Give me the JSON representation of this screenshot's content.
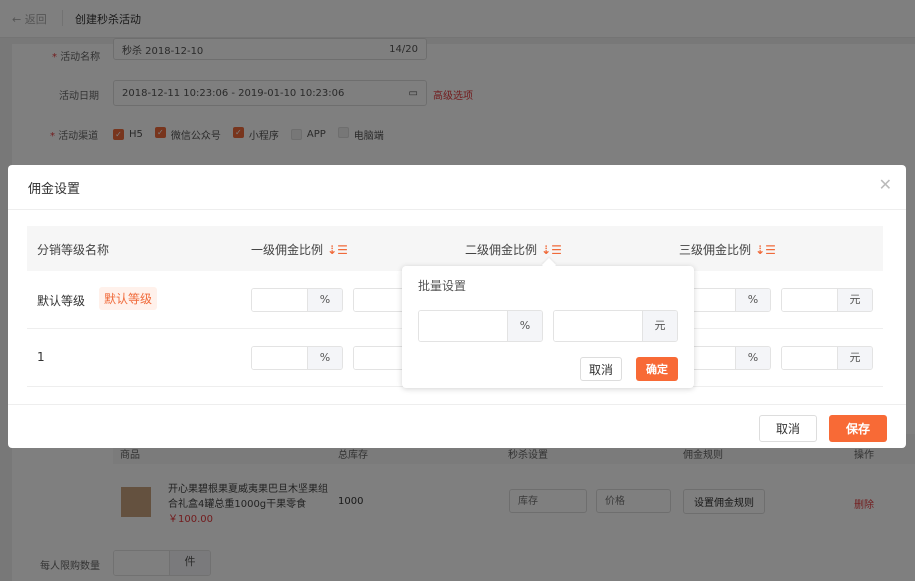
{
  "topbar": {
    "back": "返回",
    "title": "创建秒杀活动"
  },
  "form": {
    "name_label": "活动名称",
    "name_value": "秒杀 2018-12-10",
    "name_count": "14/20",
    "date_label": "活动日期",
    "date_value": "2018-12-11 10:23:06 - 2019-01-10 10:23:06",
    "advanced": "高级选项",
    "channel_label": "活动渠道",
    "channels": [
      {
        "label": "H5",
        "checked": true
      },
      {
        "label": "微信公众号",
        "checked": true
      },
      {
        "label": "小程序",
        "checked": true
      },
      {
        "label": "APP",
        "checked": false
      },
      {
        "label": "电脑端",
        "checked": false
      }
    ],
    "goods_headers": [
      "商品",
      "总库存",
      "秒杀设置",
      "佣金规则",
      "操作"
    ],
    "goods": {
      "name": "开心果碧根果夏威夷果巴旦木坚果组合礼盒4罐总重1000g干果零食",
      "price": "￥100.00",
      "stock": "1000",
      "stock_placeholder": "库存",
      "price_placeholder": "价格",
      "rule_button": "设置佣金规则",
      "delete": "删除"
    },
    "limit_label": "每人限购数量",
    "limit_unit": "件"
  },
  "modal": {
    "title": "佣金设置",
    "headers": [
      "分销等级名称",
      "一级佣金比例",
      "二级佣金比例",
      "三级佣金比例"
    ],
    "rows": [
      {
        "name": "默认等级",
        "tag": "默认等级"
      },
      {
        "name": "1",
        "tag": null
      }
    ],
    "percent_unit": "%",
    "yuan_unit": "元",
    "cancel": "取消",
    "save": "保存"
  },
  "popover": {
    "title": "批量设置",
    "percent_unit": "%",
    "yuan_unit": "元",
    "cancel": "取消",
    "confirm": "确定"
  }
}
